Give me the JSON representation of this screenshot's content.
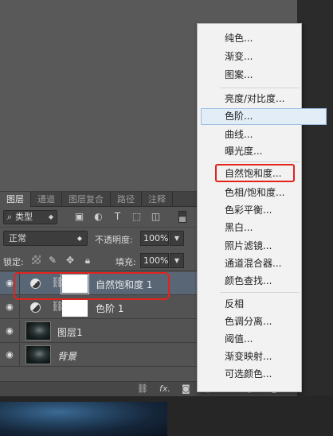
{
  "menu": {
    "group1": [
      "纯色...",
      "渐变...",
      "图案..."
    ],
    "group2": [
      "亮度/对比度...",
      "色阶...",
      "曲线...",
      "曝光度..."
    ],
    "group3": [
      "自然饱和度...",
      "色相/饱和度...",
      "色彩平衡...",
      "黑白...",
      "照片滤镜...",
      "通道混合器...",
      "颜色查找..."
    ],
    "group4": [
      "反相",
      "色调分离...",
      "阈值...",
      "渐变映射...",
      "可选颜色..."
    ]
  },
  "panel": {
    "tabs": [
      "图层",
      "通道",
      "图层复合",
      "路径",
      "注释"
    ],
    "kind_label": "类型",
    "blend_mode": "正常",
    "opacity_label": "不透明度:",
    "opacity_value": "100%",
    "lock_label": "锁定:",
    "fill_label": "填充:",
    "fill_value": "100%",
    "footer_fx": "fx."
  },
  "layers": [
    {
      "name": "自然饱和度 1",
      "type": "adjustment",
      "selected": true
    },
    {
      "name": "色阶 1",
      "type": "adjustment",
      "selected": false
    },
    {
      "name": "图层1",
      "type": "image",
      "selected": false
    },
    {
      "name": "背景",
      "type": "image",
      "selected": false
    }
  ],
  "colors": {
    "annotation_red": "#e2221c",
    "selection_blue": "#596675"
  }
}
